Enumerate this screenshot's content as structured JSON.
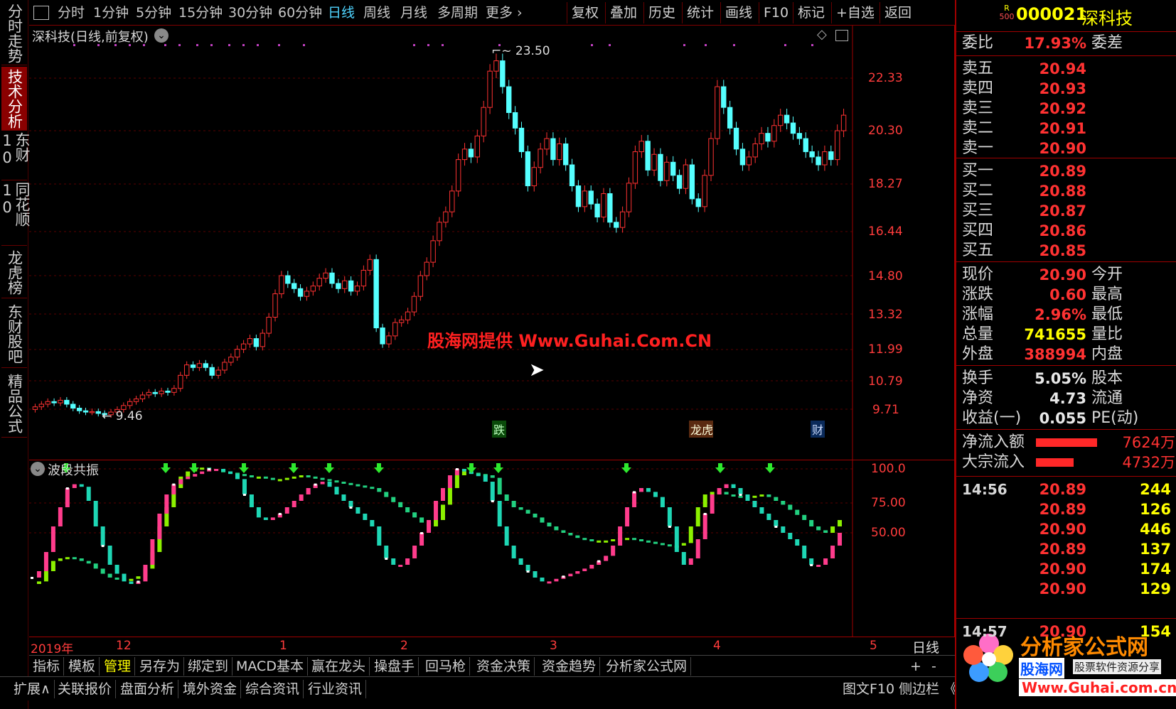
{
  "left_tabs": [
    {
      "label": "分时走势",
      "active": false
    },
    {
      "label": "技术分析",
      "active": true
    },
    {
      "label": "东财10",
      "active": false
    },
    {
      "label": "同花顺10",
      "active": false
    },
    {
      "label": "龙虎榜",
      "active": false
    },
    {
      "label": "东财股吧",
      "active": false
    },
    {
      "label": "精品公式",
      "active": false
    }
  ],
  "toolbar": {
    "periods": [
      "分时",
      "1分钟",
      "5分钟",
      "15分钟",
      "30分钟",
      "60分钟",
      "日线",
      "周线",
      "月线",
      "多周期",
      "更多"
    ],
    "selected_period": "日线",
    "right_buttons": [
      "复权",
      "叠加",
      "历史",
      "统计",
      "画线",
      "F10",
      "标记",
      "+自选",
      "返回"
    ]
  },
  "main_chart": {
    "title": "深科技(日线,前复权)",
    "y_ticks": [
      "22.33",
      "20.30",
      "18.27",
      "16.44",
      "14.80",
      "13.32",
      "11.99",
      "10.79",
      "9.71"
    ],
    "high_label": "23.50",
    "low_label": "9.46",
    "event_tags": [
      "跌",
      "龙虎榜",
      "财"
    ],
    "watermark": "股海网提供 Www.Guhai.Com.CN"
  },
  "indicator": {
    "title": "波段共振",
    "y_ticks": [
      "100.0",
      "75.00",
      "50.00"
    ]
  },
  "x_axis": {
    "labels": [
      "2019年",
      "12",
      "1",
      "2",
      "3",
      "4",
      "5"
    ],
    "period_label": "日线"
  },
  "bottom_tabs": {
    "row1": [
      "指标",
      "模板",
      "管理",
      "另存为",
      "绑定到",
      "MACD基本",
      "赢在龙头",
      "操盘手",
      "回马枪",
      "资金决策",
      "资金趋势",
      "分析家公式网"
    ],
    "row1_selected": "管理",
    "row1_right": [
      "+",
      "-"
    ],
    "row2": [
      "扩展∧",
      "关联报价",
      "盘面分析",
      "境外资金",
      "综合资讯",
      "行业资讯"
    ],
    "row2_right": "图文F10 侧边栏 《"
  },
  "quote": {
    "badge_top": "R",
    "badge_bottom": "500",
    "code": "000021",
    "name": "深科技",
    "weibi_label": "委比",
    "weibi_value": "17.93%",
    "weicha_label": "委差",
    "asks": [
      {
        "label": "卖五",
        "price": "20.94"
      },
      {
        "label": "卖四",
        "price": "20.93"
      },
      {
        "label": "卖三",
        "price": "20.92"
      },
      {
        "label": "卖二",
        "price": "20.91"
      },
      {
        "label": "卖一",
        "price": "20.90"
      }
    ],
    "bids": [
      {
        "label": "买一",
        "price": "20.89"
      },
      {
        "label": "买二",
        "price": "20.88"
      },
      {
        "label": "买三",
        "price": "20.87"
      },
      {
        "label": "买四",
        "price": "20.86"
      },
      {
        "label": "买五",
        "price": "20.85"
      }
    ],
    "stats1": [
      {
        "label": "现价",
        "value": "20.90",
        "right": "今开",
        "color": "#ff3232"
      },
      {
        "label": "涨跌",
        "value": "0.60",
        "right": "最高",
        "color": "#ff3232"
      },
      {
        "label": "涨幅",
        "value": "2.96%",
        "right": "最低",
        "color": "#ff3232"
      },
      {
        "label": "总量",
        "value": "741655",
        "right": "量比",
        "color": "#ffff00"
      },
      {
        "label": "外盘",
        "value": "388994",
        "right": "内盘",
        "color": "#ff3232"
      }
    ],
    "stats2": [
      {
        "label": "换手",
        "value": "5.05%",
        "right": "股本"
      },
      {
        "label": "净资",
        "value": "4.73",
        "right": "流通"
      },
      {
        "label": "收益(一)",
        "value": "0.055",
        "right": "PE(动)"
      }
    ],
    "flows": [
      {
        "label": "净流入额",
        "value": "7624万",
        "bar": 0.78
      },
      {
        "label": "大宗流入",
        "value": "4732万",
        "bar": 0.48
      }
    ],
    "ticks": [
      {
        "time": "14:56",
        "price": "20.89",
        "vol": "244"
      },
      {
        "time": "",
        "price": "20.89",
        "vol": "126"
      },
      {
        "time": "",
        "price": "20.90",
        "vol": "446"
      },
      {
        "time": "",
        "price": "20.89",
        "vol": "137"
      },
      {
        "time": "",
        "price": "20.90",
        "vol": "174"
      },
      {
        "time": "",
        "price": "20.90",
        "vol": "129"
      },
      {
        "time": "14:57",
        "price": "20.90",
        "vol": "154"
      }
    ],
    "logo_text1": "分析家公式网",
    "logo_text2": "股海网",
    "logo_text3": "股票软件资源分享",
    "logo_text4": "Www.Guhai.com.cn"
  },
  "colors": {
    "up": "#ff3232",
    "down": "#5ff",
    "frame": "#a00000",
    "accent": "#4fd4ff"
  }
}
